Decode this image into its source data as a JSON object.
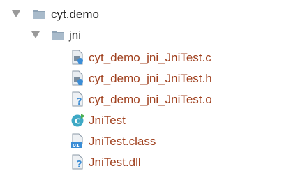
{
  "tree": {
    "root": {
      "label": "cyt.demo",
      "expanded": true,
      "icon": "folder-icon"
    },
    "child_folder": {
      "label": "jni",
      "expanded": true,
      "icon": "folder-icon"
    },
    "files": [
      {
        "label": "cyt_demo_jni_JniTest.c",
        "icon": "c-file-icon"
      },
      {
        "label": "cyt_demo_jni_JniTest.h",
        "icon": "h-file-icon"
      },
      {
        "label": "cyt_demo_jni_JniTest.o",
        "icon": "unknown-file-icon"
      },
      {
        "label": "JniTest",
        "icon": "java-class-icon"
      },
      {
        "label": "JniTest.class",
        "icon": "class-file-icon"
      },
      {
        "label": "JniTest.dll",
        "icon": "unknown-file-icon"
      }
    ]
  },
  "colors": {
    "file_text": "#a0411f",
    "folder_text": "#1e1e1e",
    "arrow": "#9a9a9a",
    "folder": "#8fa3b5",
    "class_icon": "#3fa9c5"
  }
}
